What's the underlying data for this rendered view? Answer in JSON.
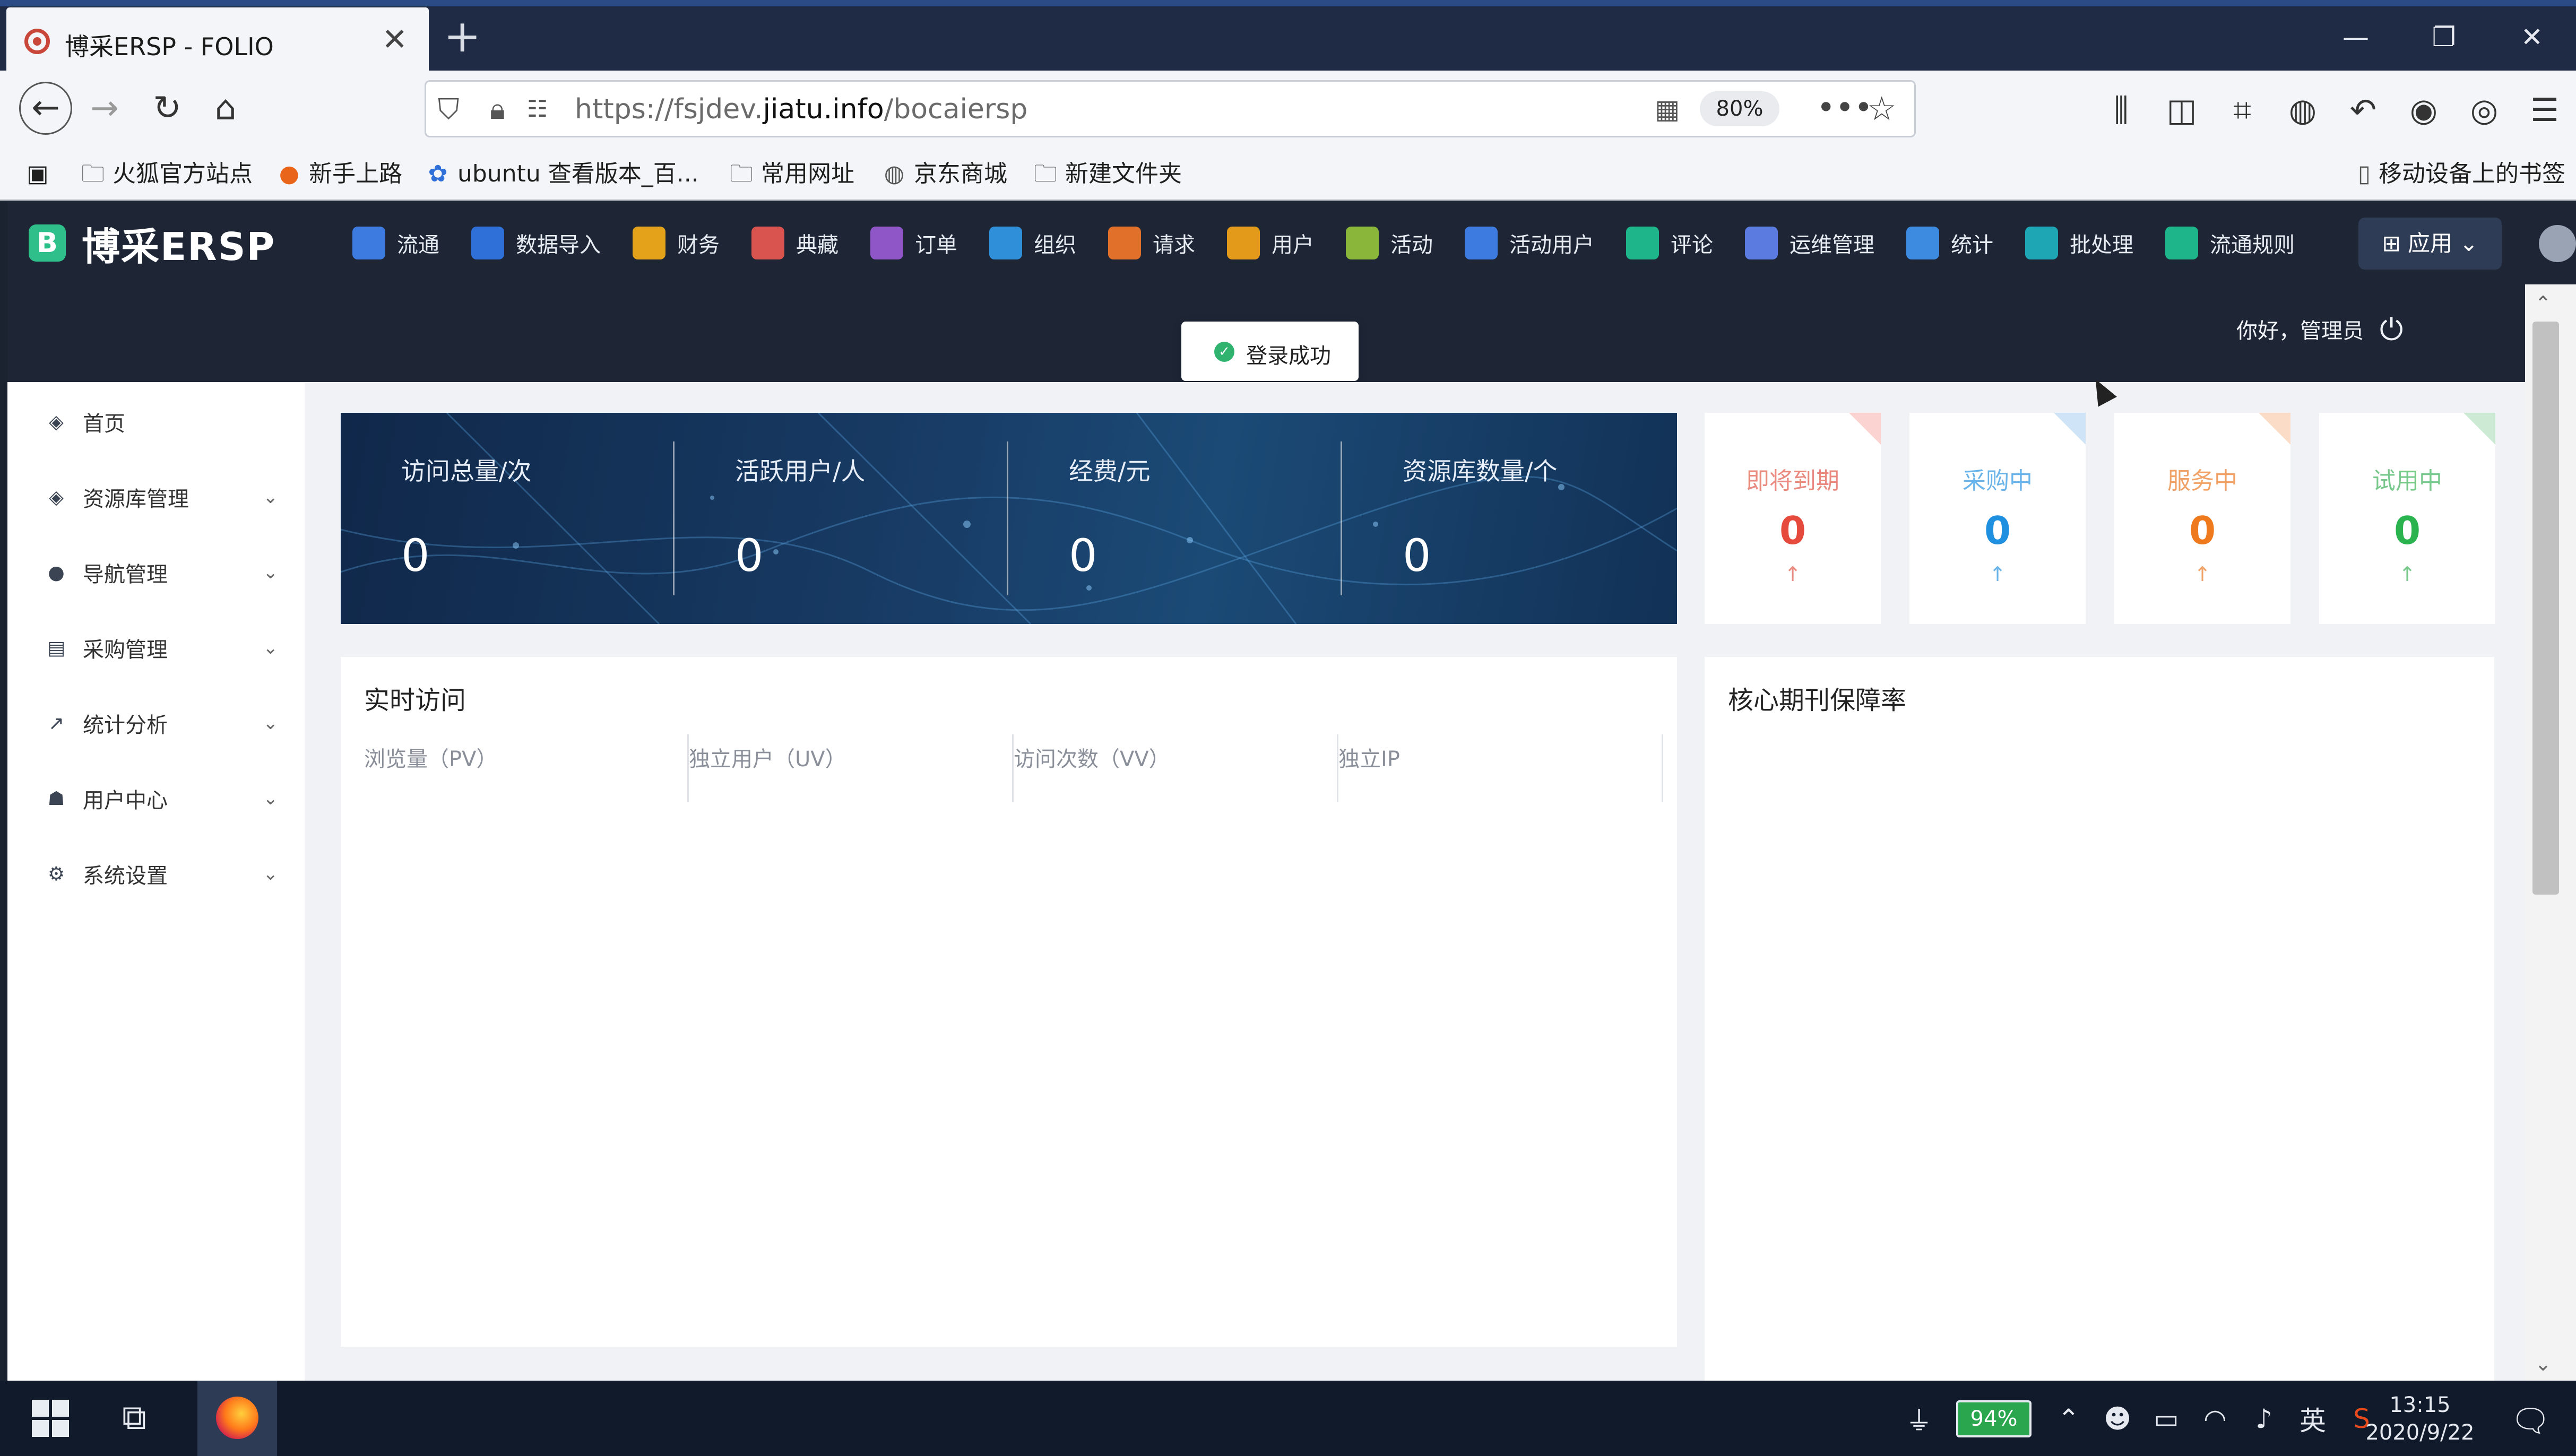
{
  "browser": {
    "tab_title": "博采ERSP - FOLIO",
    "close_glyph": "✕",
    "new_tab_glyph": "+",
    "url_prefix": "https://fsjdev.",
    "url_domain": "jiatu.info",
    "url_path": "/bocaiersp",
    "zoom": "80%",
    "bookmarks": [
      "火狐官方站点",
      "新手上路",
      "ubuntu 查看版本_百...",
      "常用网址",
      "京东商城",
      "新建文件夹"
    ],
    "mobile_bookmarks": "移动设备上的书签"
  },
  "app": {
    "logo_text": "博采ERSP",
    "logo_mark": "B",
    "menu": [
      {
        "label": "流通",
        "color": "#3d7be0"
      },
      {
        "label": "数据导入",
        "color": "#2f6fd8"
      },
      {
        "label": "财务",
        "color": "#e3a21a"
      },
      {
        "label": "典藏",
        "color": "#d9534f"
      },
      {
        "label": "订单",
        "color": "#8e56c7"
      },
      {
        "label": "组织",
        "color": "#2f8fd8"
      },
      {
        "label": "请求",
        "color": "#e0702a"
      },
      {
        "label": "用户",
        "color": "#e39a1a"
      },
      {
        "label": "活动",
        "color": "#8ab63a"
      },
      {
        "label": "活动用户",
        "color": "#3d7be0"
      },
      {
        "label": "评论",
        "color": "#1fb58a"
      },
      {
        "label": "运维管理",
        "color": "#5b7be0"
      },
      {
        "label": "统计",
        "color": "#3d8be0"
      },
      {
        "label": "批处理",
        "color": "#1fa6b5"
      },
      {
        "label": "流通规则",
        "color": "#1fb58a"
      }
    ],
    "apps_label": "应用",
    "greeting": "你好，管理员",
    "toast": "登录成功"
  },
  "sidebar": {
    "items": [
      {
        "label": "首页",
        "icon": "layers-icon"
      },
      {
        "label": "资源库管理",
        "icon": "layers-icon"
      },
      {
        "label": "导航管理",
        "icon": "compass-icon"
      },
      {
        "label": "采购管理",
        "icon": "cart-icon"
      },
      {
        "label": "统计分析",
        "icon": "trend-icon"
      },
      {
        "label": "用户中心",
        "icon": "users-icon"
      },
      {
        "label": "系统设置",
        "icon": "gear-icon"
      }
    ]
  },
  "stats": [
    {
      "label": "访问总量/次",
      "value": "0"
    },
    {
      "label": "活跃用户/人",
      "value": "0"
    },
    {
      "label": "经费/元",
      "value": "0"
    },
    {
      "label": "资源库数量/个",
      "value": "0"
    }
  ],
  "mini_cards": [
    {
      "label": "即将到期",
      "value": "0",
      "color": "#e64a3c",
      "label_color": "#e9897f",
      "corner": "#fbd4d1"
    },
    {
      "label": "采购中",
      "value": "0",
      "color": "#1f8fe0",
      "label_color": "#6ab4ea",
      "corner": "#cfe5f7"
    },
    {
      "label": "服务中",
      "value": "0",
      "color": "#ee7a1d",
      "label_color": "#f0a267",
      "corner": "#fbdcc6"
    },
    {
      "label": "试用中",
      "value": "0",
      "color": "#2bb34f",
      "label_color": "#79c98d",
      "corner": "#cdebd4"
    }
  ],
  "arrow_glyph": "↑",
  "realtime": {
    "title": "实时访问",
    "columns": [
      "浏览量（PV）",
      "独立用户（UV）",
      "访问次数（VV）",
      "独立IP"
    ]
  },
  "core_panel": {
    "title": "核心期刊保障率"
  },
  "taskbar": {
    "battery": "94%",
    "ime": "英",
    "time": "13:15",
    "date": "2020/9/22"
  }
}
